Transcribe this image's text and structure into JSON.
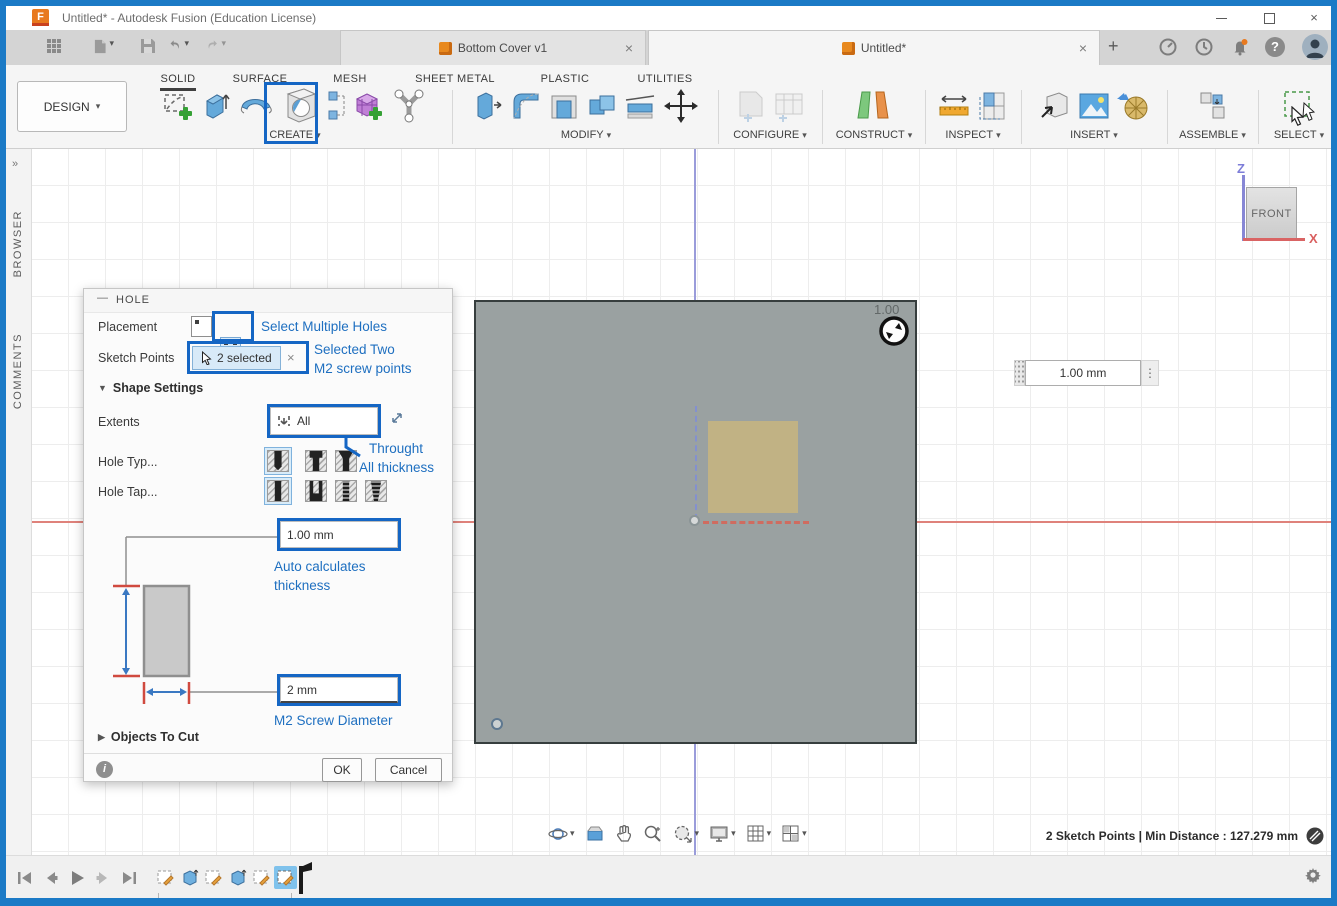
{
  "window": {
    "title": "Untitled* - Autodesk Fusion (Education License)"
  },
  "tabbar": {
    "tabs": [
      {
        "label": "Bottom Cover v1"
      },
      {
        "label": "Untitled*"
      }
    ]
  },
  "ribbon": {
    "design_label": "DESIGN",
    "tabs": [
      "SOLID",
      "SURFACE",
      "MESH",
      "SHEET METAL",
      "PLASTIC",
      "UTILITIES"
    ],
    "active_tab": "SOLID",
    "groups": {
      "create": "CREATE",
      "modify": "MODIFY",
      "configure": "CONFIGURE",
      "construct": "CONSTRUCT",
      "inspect": "INSPECT",
      "insert": "INSERT",
      "assemble": "ASSEMBLE",
      "select": "SELECT"
    }
  },
  "side_panel": {
    "browser": "BROWSER",
    "comments": "COMMENTS"
  },
  "dialog": {
    "title": "HOLE",
    "placement_label": "Placement",
    "sketch_points_label": "Sketch Points",
    "sketch_points_value": "2 selected",
    "shape_settings_label": "Shape Settings",
    "extents_label": "Extents",
    "extents_value": "All",
    "hole_type_label": "Hole Typ...",
    "hole_tap_label": "Hole Tap...",
    "depth_value": "1.00 mm",
    "diameter_value": "2 mm",
    "objects_to_cut_label": "Objects To Cut",
    "ok_label": "OK",
    "cancel_label": "Cancel"
  },
  "annotations": {
    "accent_color": "#1566c4",
    "select_multiple": "Select Multiple Holes",
    "selected_two_line1": "Selected Two",
    "selected_two_line2": "M2 screw points",
    "through_line1": "Throught",
    "through_line2": "All thickness",
    "auto_line1": "Auto calculates",
    "auto_line2": "thickness",
    "m2_diameter": "M2 Screw Diameter"
  },
  "canvas": {
    "viewcube_face": "FRONT",
    "axis_z": "Z",
    "axis_x": "X",
    "manipulator_value": "1.00",
    "dim_input_value": "1.00 mm"
  },
  "statusbar": {
    "selection_info": "2 Sketch Points | Min Distance : 127.279 mm"
  },
  "glyphs": {
    "caret": "▾",
    "close": "×",
    "plus": "+",
    "chevron_right": "»",
    "minimize": "—",
    "dots_vertical": "⋮",
    "tri_down": "▼",
    "tri_right": "▶",
    "info": "i",
    "help": "?"
  },
  "colors": {
    "window_border": "#1b7ac6",
    "annotation_blue": "#1e6fc0",
    "body_gray": "#9aa1a1",
    "selection_tan": "#c5b481",
    "axis_red": "#df827b",
    "axis_purple": "#9a9cda"
  }
}
